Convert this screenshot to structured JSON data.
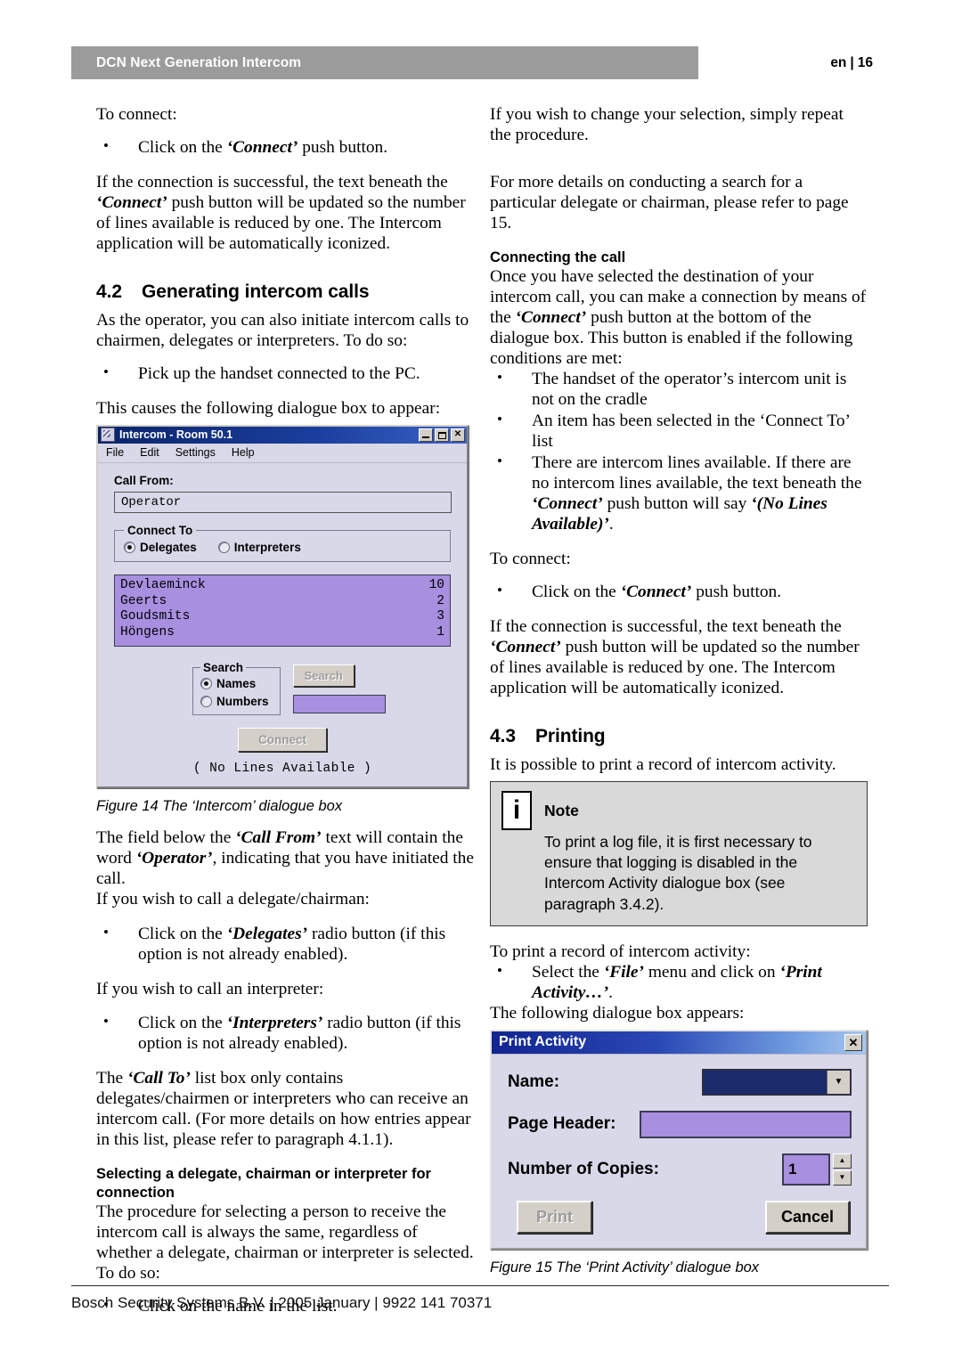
{
  "header": {
    "title": "DCN Next Generation Intercom",
    "lang": "en",
    "separator": "|",
    "page": "16"
  },
  "left_column": {
    "p1": "To connect:",
    "b1": "Click on the ‘Connect’ push button.",
    "p2": "If the connection is successful, the text beneath the ‘Connect’ push button will be updated so the number of lines available is reduced by one. The Intercom application will be automatically iconized.",
    "section_number": "4.2",
    "section_title": "Generating intercom calls",
    "p3": "As the operator, you can also initiate intercom calls to chairmen, delegates or interpreters. To do so:",
    "b2": "Pick up the handset connected to the PC.",
    "p4": "This causes the following dialogue box to appear:",
    "figure_caption": "Figure 14 The ‘Intercom’ dialogue box",
    "p5": "The field below the ‘Call From’ text will contain the word ‘Operator’, indicating that you have initiated the call.",
    "p6": "If you wish to call a delegate/chairman:",
    "b3": "Click on the ‘Delegates’ radio button (if this option is not already enabled).",
    "p7": "If you wish to call an interpreter:",
    "b4": "Click on the ‘Interpreters’ radio button (if this option is not already enabled).",
    "p8": "The ‘Call To’ list box only contains delegates/chairmen or interpreters who can receive an intercom call. (For more details on how entries appear in this list, please refer to paragraph 4.1.1).",
    "subheading": "Selecting a delegate, chairman or interpreter for connection",
    "p9": "The procedure for selecting a person to receive the intercom call is always the same, regardless of whether a delegate, chairman or interpreter is selected. To do so:",
    "b5": "Click on the name in the list."
  },
  "intercom_dialog": {
    "title": "Intercom - Room 50.1",
    "window_buttons": {
      "minimize": "minimize-icon",
      "maximize": "maximize-icon",
      "close": "✕"
    },
    "menu": [
      "File",
      "Edit",
      "Settings",
      "Help"
    ],
    "call_from_label": "Call From:",
    "call_from_value": "Operator",
    "connect_to_legend": "Connect To",
    "connect_to_options": [
      {
        "label": "Delegates",
        "selected": true
      },
      {
        "label": "Interpreters",
        "selected": false
      }
    ],
    "list_entries": [
      {
        "name": "Devlaeminck",
        "number": "10"
      },
      {
        "name": "Geerts",
        "number": "2"
      },
      {
        "name": "Goudsmits",
        "number": "3"
      },
      {
        "name": "Höngens",
        "number": "1"
      }
    ],
    "search_legend": "Search",
    "search_options": [
      {
        "label": "Names",
        "selected": true
      },
      {
        "label": "Numbers",
        "selected": false
      }
    ],
    "search_button": "Search",
    "search_input_value": "",
    "connect_button": "Connect",
    "status_text": "( No Lines Available )"
  },
  "right_column": {
    "p1": "If you wish to change your selection, simply repeat the procedure.",
    "p2": "For more details on conducting a search for a particular delegate or chairman, please refer to page 15.",
    "subheading1": "Connecting the call",
    "p3": "Once you have selected the destination of your intercom call, you can make a connection by means of the ‘Connect’ push button at the bottom of the dialogue box. This button is enabled if the following conditions are met:",
    "b1": "The handset of the operator’s intercom unit is not on the cradle",
    "b2": "An item has been selected in the ‘Connect To’ list",
    "b3": "There are intercom lines available. If there are no intercom lines available, the text beneath the ‘Connect’ push button will say ‘(No Lines Available)’.",
    "p4": "To connect:",
    "b4": "Click on the ‘Connect’ push button.",
    "p5": "If the connection is successful, the text beneath the ‘Connect’ push button will be updated so the number of lines available is reduced by one. The Intercom application will be automatically iconized.",
    "section_number": "4.3",
    "section_title": "Printing",
    "p6": "It is possible to print a record of intercom activity.",
    "note": {
      "icon": "i",
      "label": "Note",
      "text": "To print a log file, it is first necessary to ensure that logging is disabled in the Intercom Activity dialogue box (see paragraph 3.4.2)."
    },
    "p7": "To print a record of intercom activity:",
    "b5": "Select the ‘File’ menu and click on ‘Print Activity…’.",
    "p8": "The following dialogue box appears:",
    "figure_caption": "Figure 15 The ‘Print Activity’ dialogue box"
  },
  "print_dialog": {
    "title": "Print Activity",
    "close_button": "✕",
    "name_label": "Name:",
    "name_value": "",
    "name_dropdown_arrow": "▼",
    "page_header_label": "Page Header:",
    "page_header_value": "",
    "copies_label": "Number of Copies:",
    "copies_value": "1",
    "spin_up": "▲",
    "spin_down": "▼",
    "print_button": "Print",
    "cancel_button": "Cancel"
  },
  "footer": {
    "text": "Bosch Security Systems B.V. | 2005 January | 9922 141 70371"
  },
  "colors": {
    "header_bar": "#9b9b9b",
    "dialog_face": "#d8d8e8",
    "list_highlight": "#a88fe0",
    "title_bar_blue": "#0a246a",
    "note_bg": "#d9d9d9"
  }
}
